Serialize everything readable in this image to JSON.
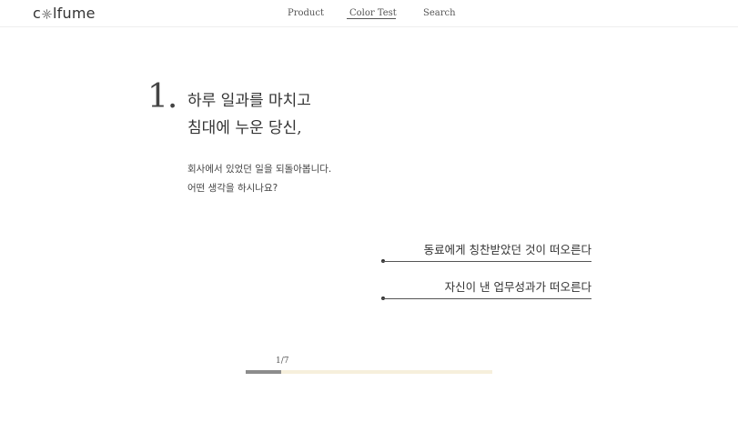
{
  "header": {
    "logo": {
      "prefix": "c",
      "suffix": "lfume",
      "mark_icon": "sun-flower-icon"
    },
    "nav": {
      "product": "Product",
      "color_test": "Color Test",
      "search": "Search",
      "active": "Color Test"
    }
  },
  "question": {
    "number": "1.",
    "title_line_1": "하루 일과를 마치고",
    "title_line_2": "침대에 누운 당신,",
    "desc_line_1": "회사에서 있었던 일을 되돌아봅니다.",
    "desc_line_2": "어떤 생각을 하시나요?"
  },
  "answers": [
    {
      "label": "동료에게 칭찬받았던 것이 떠오른다"
    },
    {
      "label": "자신이 낸 업무성과가 떠오른다"
    }
  ],
  "progress": {
    "label": "1/7",
    "current": 1,
    "total": 7,
    "fraction": 0.1428,
    "track_color": "#f6efdc",
    "fill_color": "#8c8c8c"
  }
}
